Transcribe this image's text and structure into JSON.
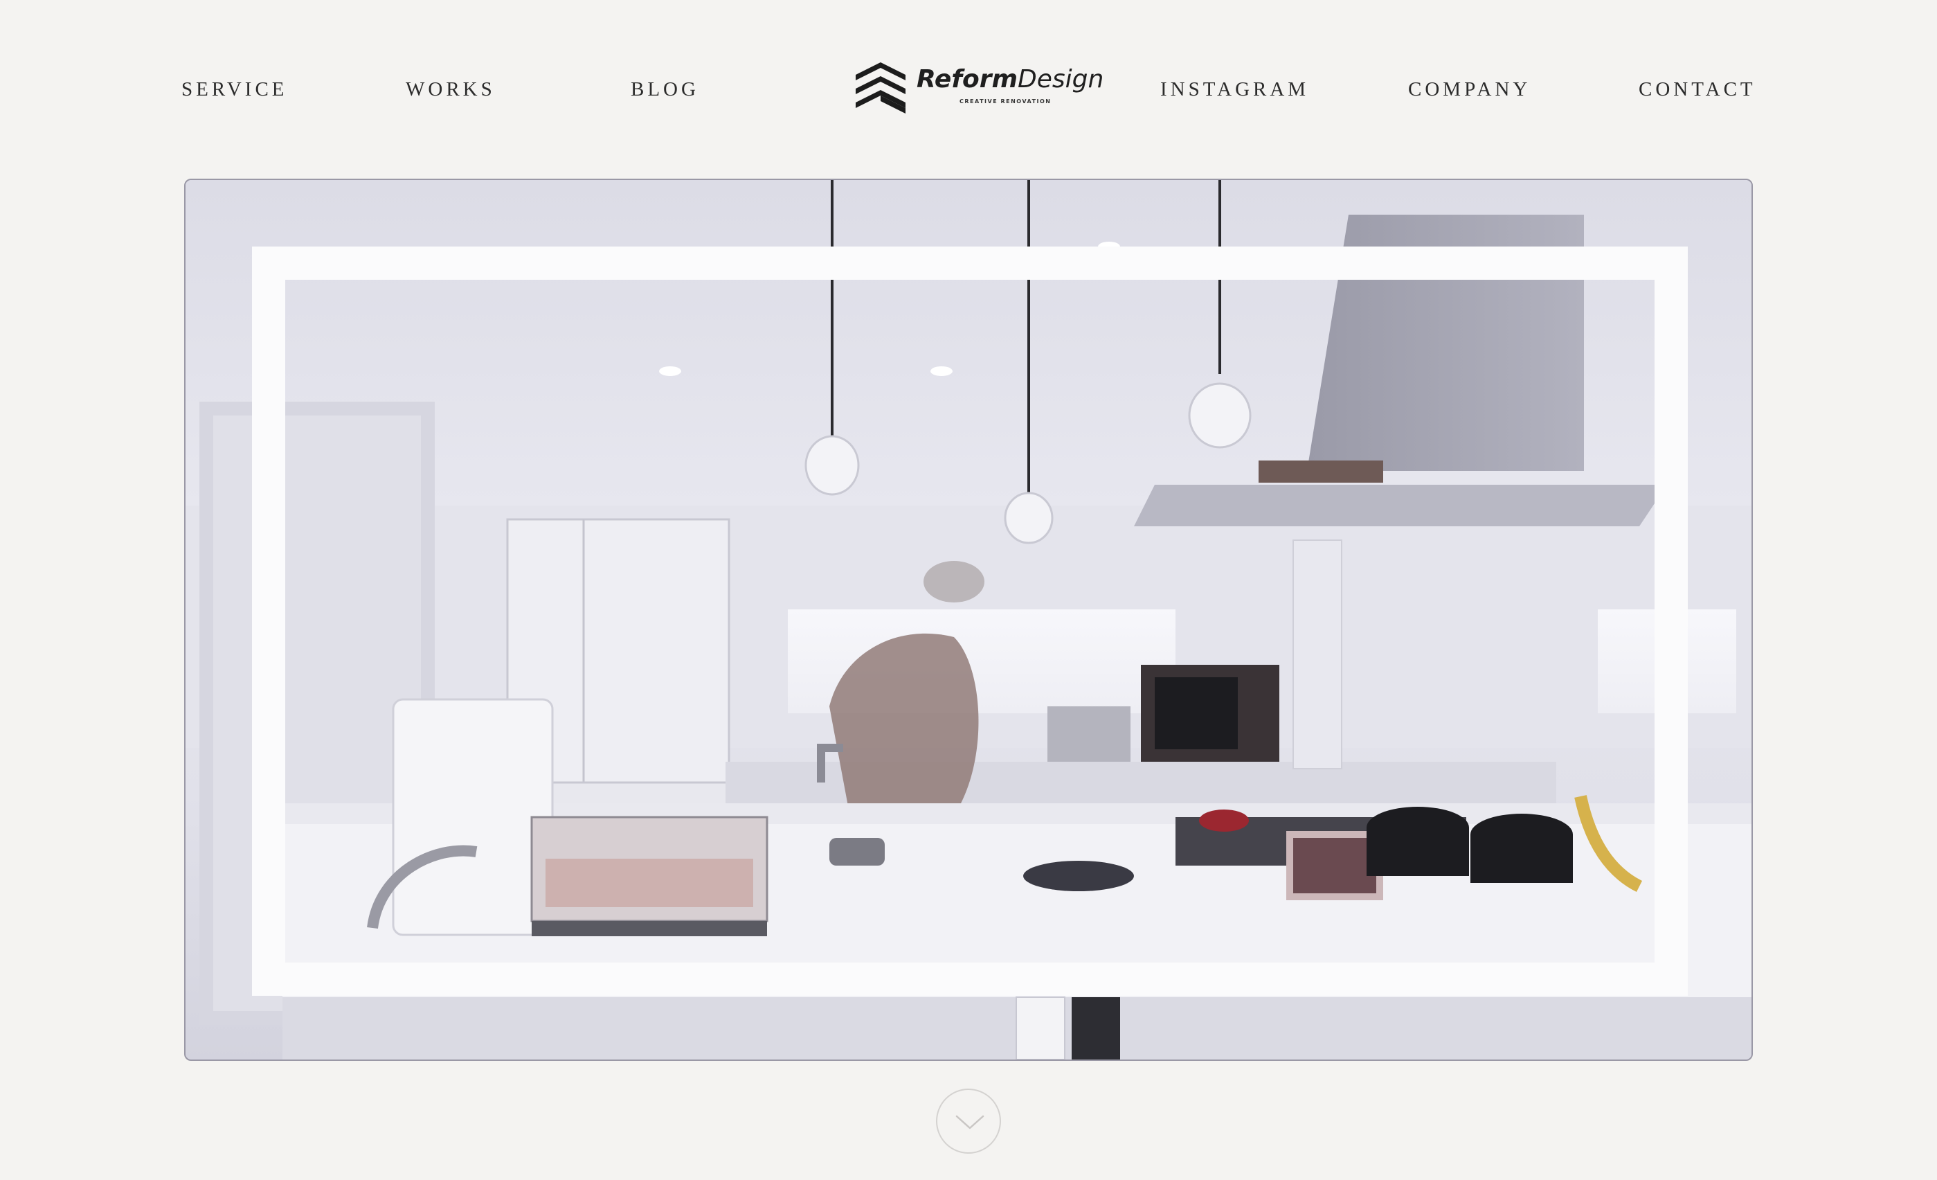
{
  "nav": {
    "left": [
      {
        "label": "SERVICE"
      },
      {
        "label": "WORKS"
      },
      {
        "label": "BLOG"
      }
    ],
    "right": [
      {
        "label": "INSTAGRAM"
      },
      {
        "label": "COMPANY"
      },
      {
        "label": "CONTACT"
      }
    ]
  },
  "logo": {
    "wordmark_bold": "Reform",
    "wordmark_light": "Design",
    "tagline": "CREATIVE RENOVATION"
  },
  "hero": {
    "image": "kitchen-interior-photo"
  },
  "scroll_button": {
    "icon": "chevron-down-icon"
  },
  "colors": {
    "background": "#f4f3f1",
    "text": "#2b2b2b",
    "frame": "#fbfbfc"
  }
}
